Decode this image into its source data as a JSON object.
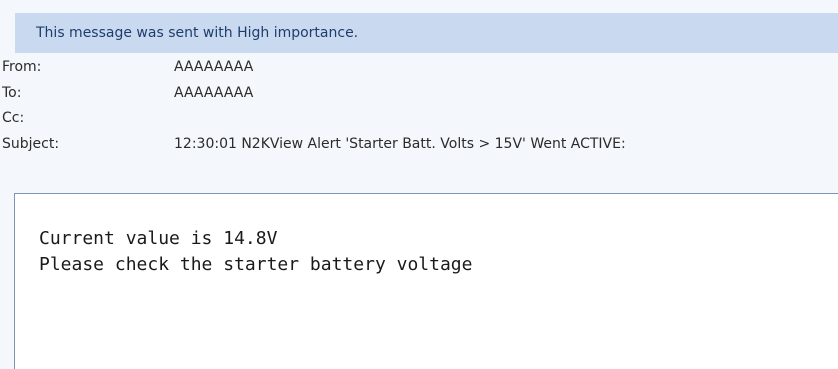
{
  "info_bar": {
    "text": "This message was sent with High importance."
  },
  "headers": {
    "from_label": "From:",
    "from_value": "AAAAAAAA",
    "to_label": "To:",
    "to_value": "AAAAAAAA",
    "cc_label": "Cc:",
    "cc_value": "",
    "subject_label": "Subject:",
    "subject_value": "12:30:01 N2KView Alert 'Starter Batt. Volts > 15V' Went ACTIVE:"
  },
  "body": {
    "line1": "Current value is 14.8V",
    "line2": "Please check the starter battery voltage"
  }
}
